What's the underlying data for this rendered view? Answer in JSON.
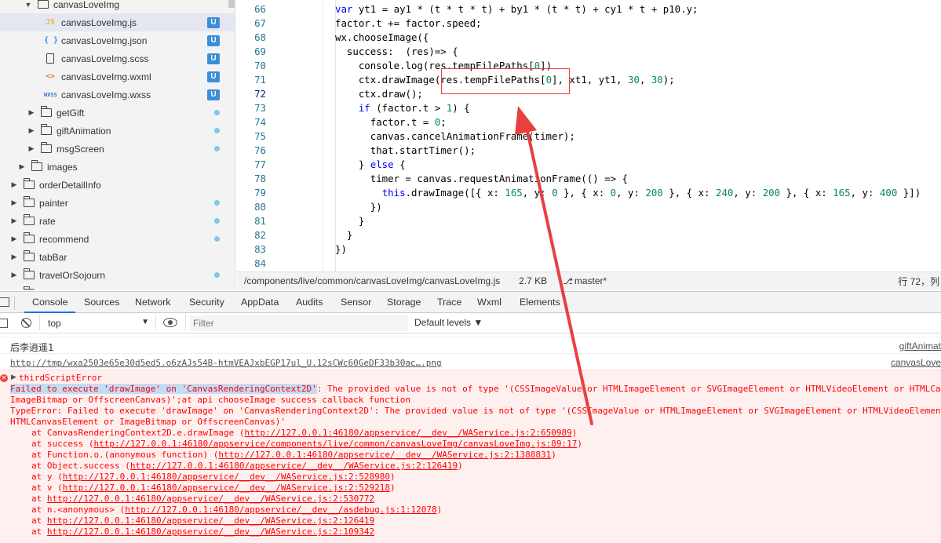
{
  "file_tree": {
    "items": [
      {
        "label": "canvasLoveImg",
        "kind": "folder-open",
        "depth": 2
      },
      {
        "label": "canvasLoveImg.js",
        "kind": "js",
        "badge": "U",
        "selected": true
      },
      {
        "label": "canvasLoveImg.json",
        "kind": "json",
        "badge": "U"
      },
      {
        "label": "canvasLoveImg.scss",
        "kind": "doc",
        "badge": "U"
      },
      {
        "label": "canvasLoveImg.wxml",
        "kind": "wxml",
        "badge": "U"
      },
      {
        "label": "canvasLoveImg.wxss",
        "kind": "wxss",
        "badge": "U"
      },
      {
        "label": "getGift",
        "kind": "folder",
        "dot": true
      },
      {
        "label": "giftAnimation",
        "kind": "folder",
        "dot": true
      },
      {
        "label": "msgScreen",
        "kind": "folder",
        "dot": true
      },
      {
        "label": "images",
        "kind": "folder"
      },
      {
        "label": "orderDetailInfo",
        "kind": "folder"
      },
      {
        "label": "painter",
        "kind": "folder",
        "dot": true
      },
      {
        "label": "rate",
        "kind": "folder",
        "dot": true
      },
      {
        "label": "recommend",
        "kind": "folder",
        "dot": true
      },
      {
        "label": "tabBar",
        "kind": "folder"
      },
      {
        "label": "travelOrSojourn",
        "kind": "folder",
        "dot": true
      },
      {
        "label": "travelOrderItem",
        "kind": "folder"
      }
    ],
    "icons": {
      "js": "JS",
      "json": "{ }",
      "wxml": "<>",
      "wxss": "WXSS"
    },
    "badge_color": "#3b8ed8",
    "dot_color": "#7ec6ef"
  },
  "editor": {
    "lines": [
      {
        "n": "66",
        "code": "var yt1 = ay1 * (t * t * t) + by1 * (t * t) + cy1 * t + p10.y;"
      },
      {
        "n": "67",
        "code": "factor.t += factor.speed;"
      },
      {
        "n": "68",
        "code": "wx.chooseImage({"
      },
      {
        "n": "69",
        "code": "  success:  (res)=> {"
      },
      {
        "n": "70",
        "code": "    console.log(res.tempFilePaths[0])"
      },
      {
        "n": "71",
        "code": "    ctx.drawImage(res.tempFilePaths[0], xt1, yt1, 30, 30);"
      },
      {
        "n": "72",
        "code": "    ctx.draw();"
      },
      {
        "n": "73",
        "code": "    if (factor.t > 1) {"
      },
      {
        "n": "74",
        "code": "      factor.t = 0;"
      },
      {
        "n": "75",
        "code": "      canvas.cancelAnimationFrame(timer);"
      },
      {
        "n": "76",
        "code": "      that.startTimer();"
      },
      {
        "n": "77",
        "code": "    } else {"
      },
      {
        "n": "78",
        "code": "      timer = canvas.requestAnimationFrame(() => {"
      },
      {
        "n": "79",
        "code": "        this.drawImage([{ x: 165, y: 0 }, { x: 0, y: 200 }, { x: 240, y: 200 }, { x: 165, y: 400 }])"
      },
      {
        "n": "80",
        "code": "      })"
      },
      {
        "n": "81",
        "code": "    }"
      },
      {
        "n": "82",
        "code": "  }"
      },
      {
        "n": "83",
        "code": "})"
      },
      {
        "n": "84",
        "code": ""
      }
    ],
    "current_line": "72"
  },
  "status_bar": {
    "path": "/components/live/common/canvasLoveImg/canvasLoveImg.js",
    "size": "2.7 KB",
    "branch_icon": "git-branch-icon",
    "branch": "master*",
    "position": "行 72，列"
  },
  "devtools": {
    "tabs": [
      "Console",
      "Sources",
      "Network",
      "Security",
      "AppData",
      "Audits",
      "Sensor",
      "Storage",
      "Trace",
      "Wxml",
      "Elements"
    ],
    "active_tab": "Console",
    "context": "top",
    "filter_placeholder": "Filter",
    "levels": "Default levels ▼"
  },
  "console": {
    "rows": [
      {
        "text": "后李逍遥1",
        "source": "giftAnimat"
      },
      {
        "text": "http://tmp/wxa2503e65e30d5ed5.o6zAJs54B-htmVEAJxbEGP17ul_U.12sCWc60GeDF33b30ac….png",
        "source": "canvasLove"
      }
    ],
    "error": {
      "title": "thirdScriptError",
      "message_lines": [
        "Failed to execute 'drawImage' on 'CanvasRenderingContext2D': The provided value is not of type '(CSSImageValue or HTMLImageElement or SVGImageElement or HTMLVideoElement or HTMLCan",
        "ImageBitmap or OffscreenCanvas)';at api chooseImage success callback function",
        "TypeError: Failed to execute 'drawImage' on 'CanvasRenderingContext2D': The provided value is not of type '(CSSImageValue or HTMLImageElement or SVGImageElement or HTMLVideoElement",
        "HTMLCanvasElement or ImageBitmap or OffscreenCanvas)'"
      ],
      "highlighted": "Failed to execute 'drawImage' on 'CanvasRenderingContext2D'",
      "stack": [
        {
          "prefix": "at CanvasRenderingContext2D.e.drawImage (",
          "link": "http://127.0.0.1:46180/appservice/__dev__/WAService.js:2:650989",
          "suffix": ")"
        },
        {
          "prefix": "at success (",
          "link": "http://127.0.0.1:46180/appservice/components/live/common/canvasLoveImg/canvasLoveImg.js:89:17",
          "suffix": ")"
        },
        {
          "prefix": "at Function.o.(anonymous function) (",
          "link": "http://127.0.0.1:46180/appservice/__dev__/WAService.js:2:1388831",
          "suffix": ")"
        },
        {
          "prefix": "at Object.success (",
          "link": "http://127.0.0.1:46180/appservice/__dev__/WAService.js:2:126419",
          "suffix": ")"
        },
        {
          "prefix": "at y (",
          "link": "http://127.0.0.1:46180/appservice/__dev__/WAService.js:2:528980",
          "suffix": ")"
        },
        {
          "prefix": "at v (",
          "link": "http://127.0.0.1:46180/appservice/__dev__/WAService.js:2:529218",
          "suffix": ")"
        },
        {
          "prefix": "at ",
          "link": "http://127.0.0.1:46180/appservice/__dev__/WAService.js:2:530772",
          "suffix": ""
        },
        {
          "prefix": "at n.<anonymous> (",
          "link": "http://127.0.0.1:46180/appservice/__dev__/asdebug.js:1:12078",
          "suffix": ")"
        },
        {
          "prefix": "at ",
          "link": "http://127.0.0.1:46180/appservice/__dev__/WAService.js:2:126419",
          "suffix": ""
        },
        {
          "prefix": "at ",
          "link": "http://127.0.0.1:46180/appservice/__dev__/WAService.js:2:109342",
          "suffix": ""
        }
      ]
    }
  },
  "annotation_color": "#e84040"
}
